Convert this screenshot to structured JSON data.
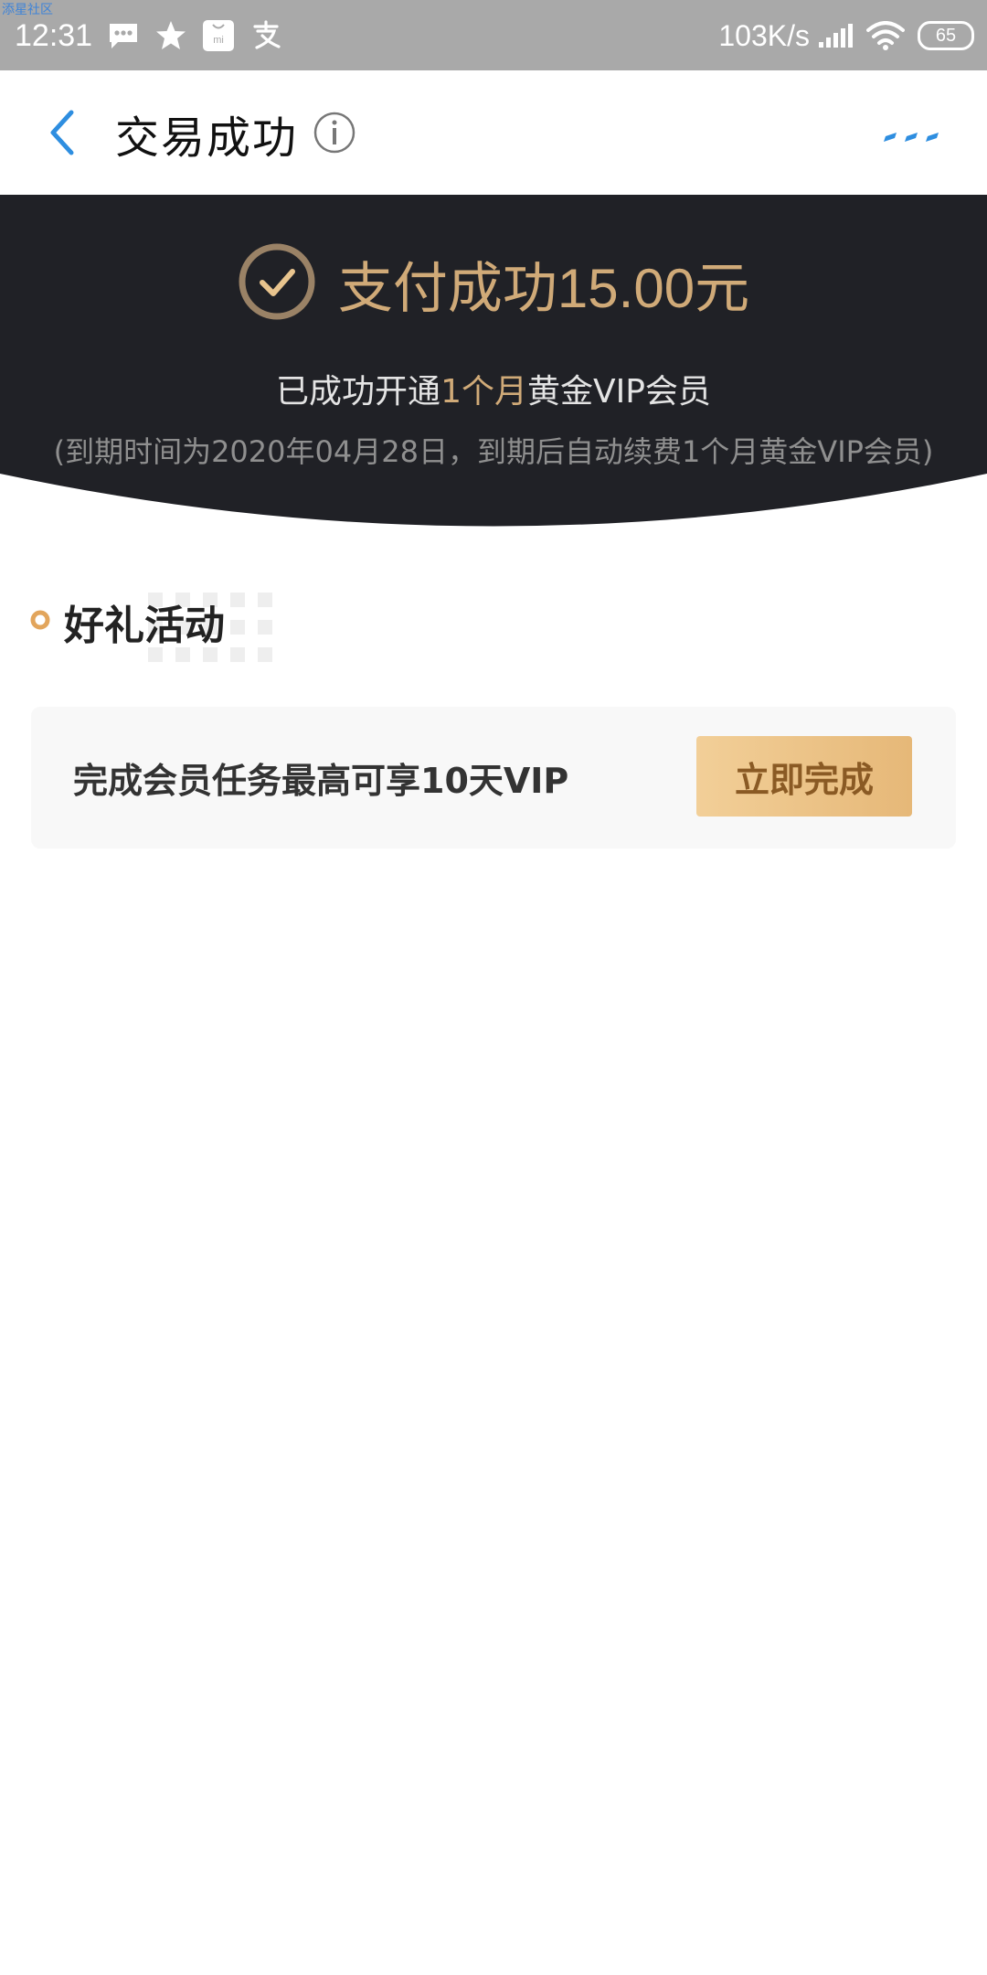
{
  "watermark": "添星社区",
  "status_bar": {
    "time": "12:31",
    "net_speed": "103K/s",
    "battery": "65",
    "icons": [
      "message-icon",
      "star-icon",
      "mi-store-icon",
      "alipay-icon",
      "signal-icon",
      "wifi-icon",
      "battery-icon"
    ]
  },
  "nav": {
    "title": "交易成功",
    "icons": [
      "back-arrow-icon",
      "info-icon",
      "more-icon"
    ],
    "accent_color": "#2e8ee0"
  },
  "hero": {
    "title": "支付成功15.00元",
    "sub_prefix": "已成功开通",
    "sub_highlight": "1个月",
    "sub_suffix": "黄金VIP会员",
    "note": "(到期时间为2020年04月28日，到期后自动续费1个月黄金VIP会员)",
    "background_color": "#202126",
    "gold_color": "#d0aa78"
  },
  "section": {
    "title": "好礼活动"
  },
  "activity": {
    "text": "完成会员任务最高可享10天VIP",
    "button_label": "立即完成"
  }
}
